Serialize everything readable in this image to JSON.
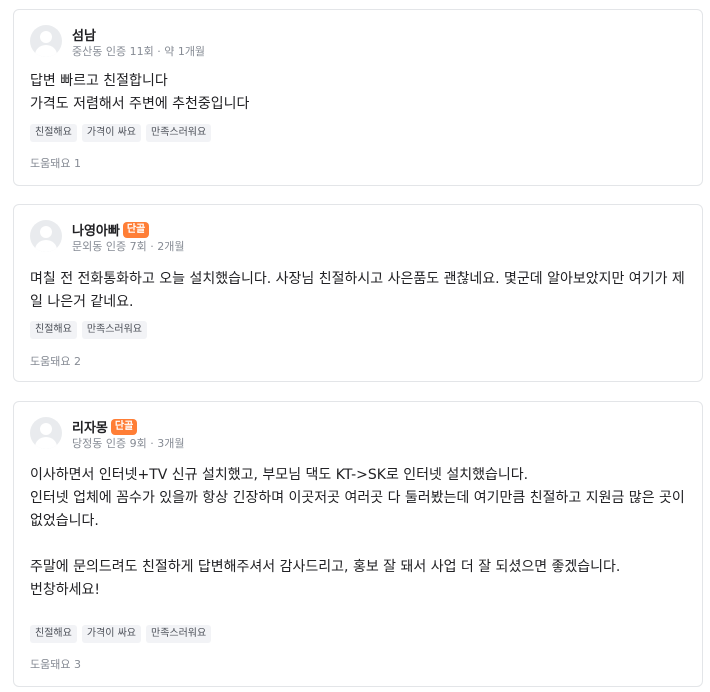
{
  "reviews": [
    {
      "author": "섬남",
      "badge": "",
      "meta": "중산동 인증 11회 · 약 1개월",
      "text": "답변 빠르고 친절합니다\n가격도 저렴해서 주변에 추천중입니다",
      "tags": [
        "친절해요",
        "가격이 싸요",
        "만족스러워요"
      ],
      "helpful": "도움돼요 1"
    },
    {
      "author": "나영아빠",
      "badge": "단골",
      "meta": "문외동 인증 7회 · 2개월",
      "text": "며칠 전 전화통화하고 오늘 설치했습니다. 사장님 친절하시고 사은품도 괜찮네요. 몇군데 알아보았지만 여기가 제일 나은거 같네요.",
      "tags": [
        "친절해요",
        "만족스러워요"
      ],
      "helpful": "도움돼요 2"
    },
    {
      "author": "리자몽",
      "badge": "단골",
      "meta": "당정동 인증 9회 · 3개월",
      "text": "이사하면서 인터넷+TV 신규 설치했고, 부모님 댁도 KT->SK로 인터넷 설치했습니다.\n인터넷 업체에 꼼수가 있을까 항상 긴장하며 이곳저곳 여러곳 다 둘러봤는데 여기만큼 친절하고 지원금 많은 곳이 없었습니다.\n\n주말에 문의드려도 친절하게 답변해주셔서 감사드리고, 홍보 잘 돼서 사업 더 잘 되셨으면 좋겠습니다.\n번창하세요!",
      "tags": [
        "친절해요",
        "가격이 싸요",
        "만족스러워요"
      ],
      "helpful": "도움돼요 3"
    }
  ]
}
